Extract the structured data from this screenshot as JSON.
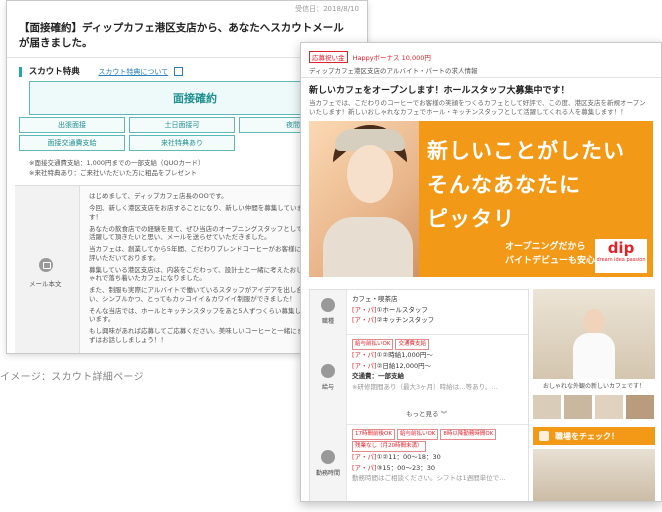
{
  "back": {
    "date": "受信日：2018/8/10",
    "title": "【面接確約】ディップカフェ港区支店から、あなたへスカウトメールが届きました。",
    "scout_label": "スカウト特典",
    "scout_link": "スカウト特典について",
    "main_button": "面接確約",
    "tags": [
      "出張面接",
      "土日面接可",
      "夜間採用",
      "面接交通費支給",
      "来社特典あり"
    ],
    "notes": [
      "※面接交通費支給：1,000円までの一部支給（QUOカード）",
      "※来社特典あり：ご来社いただいた方に粗品をプレゼント"
    ],
    "mail_label": "メール本文",
    "message": [
      "はじめまして、ディップカフェ店長のOOです。",
      "今回、新しく港区支店をお店することになり、新しい仲間を募集しています！",
      "あなたの飲食店での経験を見て、ぜひ当店のオープニングスタッフとして活躍して頂きたいと思い、メールを送らせていただきました。",
      "当カフェは、創業してから5年間、こだわりブレンドコーヒーがお客様に好評いただいております。",
      "募集している港区支店は、内装をこだわって、設計士と一緒に考えたおしゃれで落ち着いたカフェになりました。",
      "また、制服も実際にアルバイトで働いているスタッフがアイデアを出し合い、シンプルかつ、とってもカッコイイ＆カワイイ制服ができました！",
      "そんな当店では、ホールとキッチンスタッフをあと5人ずつくらい募集しています。",
      "もし興味があれば応募してご応募ください。美味しいコーヒーと一緒にまずはお話ししましょう！！"
    ]
  },
  "caption": "イメージ：スカウト詳細ページ",
  "front": {
    "badge": "応募祝い金",
    "bonus": "Happyボーナス 10,000円",
    "subtitle": "ディップカフェ港区支店のアルバイト・パートの求人情報",
    "title": "新しいカフェをオープンします！ホールスタッフ大募集中です！",
    "desc": "当カフェでは、こだわりのコーヒーでお客様の笑顔をつくるカフェとして好評で、この度、港区支店を新規オープンいたします！新しいおしゃれなカフェでホール・キッチンスタッフとして活躍してくれる人を募集します！！",
    "banner": {
      "line1": "新しいことがしたい",
      "line2": "そんなあなたに",
      "line3": "ピッタリ",
      "small1": "オープニングだから",
      "small2": "バイトデビューも安心",
      "logo": "dip",
      "logo_sub": "dream idea passion"
    },
    "job": {
      "key": "職種",
      "category": "カフェ・喫茶店",
      "item1_prefix": "[ア・パ]",
      "item1": "①ホールスタッフ",
      "item2_prefix": "[ア・パ]",
      "item2": "②キッチンスタッフ"
    },
    "pay": {
      "key": "給与",
      "chips": [
        "給与前払いOK",
        "交通費支給"
      ],
      "line1_prefix": "[ア・パ]",
      "line1": "①②時給1,000円～",
      "line2_prefix": "[ア・パ]",
      "line2": "②日給12,000円～",
      "transport": "交通費：一部支給",
      "note": "※研修期間あり（最大3ヶ月）時給は…等あり。…",
      "more": "もっと見る"
    },
    "hours": {
      "key": "勤務時間",
      "chips": [
        "17時間前後OK",
        "給与前払いOK",
        "8時以降勤務時間OK",
        "残業なし（月20時間未満）"
      ],
      "line1_prefix": "[ア・パ]",
      "line1": "①②11：00～18：30",
      "line2_prefix": "[ア・パ]",
      "line2": "③15：00～23：30",
      "note": "勤務時間はご相談ください。シフトは1週間単位で…"
    },
    "side": {
      "caption": "おしゃれな外観の新しいカフェです！",
      "check": "職場をチェック！"
    }
  }
}
